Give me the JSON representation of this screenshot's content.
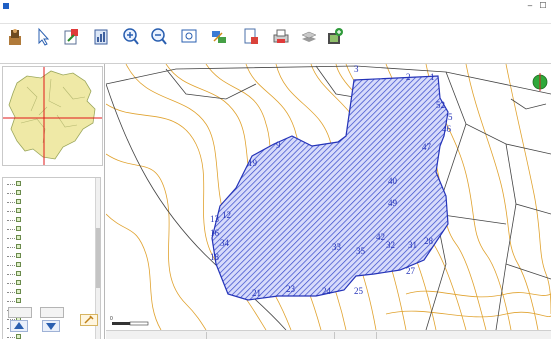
{
  "window": {
    "title": "",
    "controls": {
      "minimize": "–",
      "maximize": "☐"
    }
  },
  "menu": [
    "",
    "",
    "",
    "",
    "",
    "",
    ""
  ],
  "toolbar": [
    {
      "name": "save",
      "label": ""
    },
    {
      "name": "select",
      "label": ""
    },
    {
      "name": "export",
      "label": ""
    },
    {
      "name": "report",
      "label": ""
    },
    {
      "name": "zoom-in",
      "label": ""
    },
    {
      "name": "zoom-out",
      "label": ""
    },
    {
      "name": "full-extent",
      "label": ""
    },
    {
      "name": "transfer",
      "label": ""
    },
    {
      "name": "document",
      "label": ""
    },
    {
      "name": "print",
      "label": ""
    },
    {
      "name": "layers",
      "label": ""
    },
    {
      "name": "add-layer",
      "label": ""
    }
  ],
  "layer_panel": {
    "title": "",
    "items": [
      "",
      "",
      "",
      "",
      "",
      "",
      "",
      "",
      "",
      "",
      "",
      "",
      "",
      "",
      "",
      "",
      "",
      ""
    ],
    "buttons": {
      "btn1": "",
      "btn2": ""
    }
  },
  "map": {
    "parcel_labels": [
      "",
      "",
      "",
      "",
      "",
      "",
      "",
      "",
      "",
      "",
      "",
      ""
    ],
    "point_labels": [
      "3",
      "2",
      "1",
      "52",
      "5",
      "46",
      "47",
      "9",
      "19",
      "13",
      "12",
      "16",
      "18",
      "34",
      "35",
      "33",
      "32",
      "31",
      "28",
      "49",
      "40",
      "42",
      "27",
      "25",
      "24",
      "23",
      "21"
    ],
    "scale": {
      "left": "0",
      "right": ""
    },
    "colors": {
      "contour": "#e0a22e",
      "parcel_fill": "#5b6fe0",
      "parcel_edge": "#2433b8",
      "boundary": "#444444"
    }
  },
  "status": [
    "",
    "",
    "",
    "",
    "",
    ""
  ]
}
